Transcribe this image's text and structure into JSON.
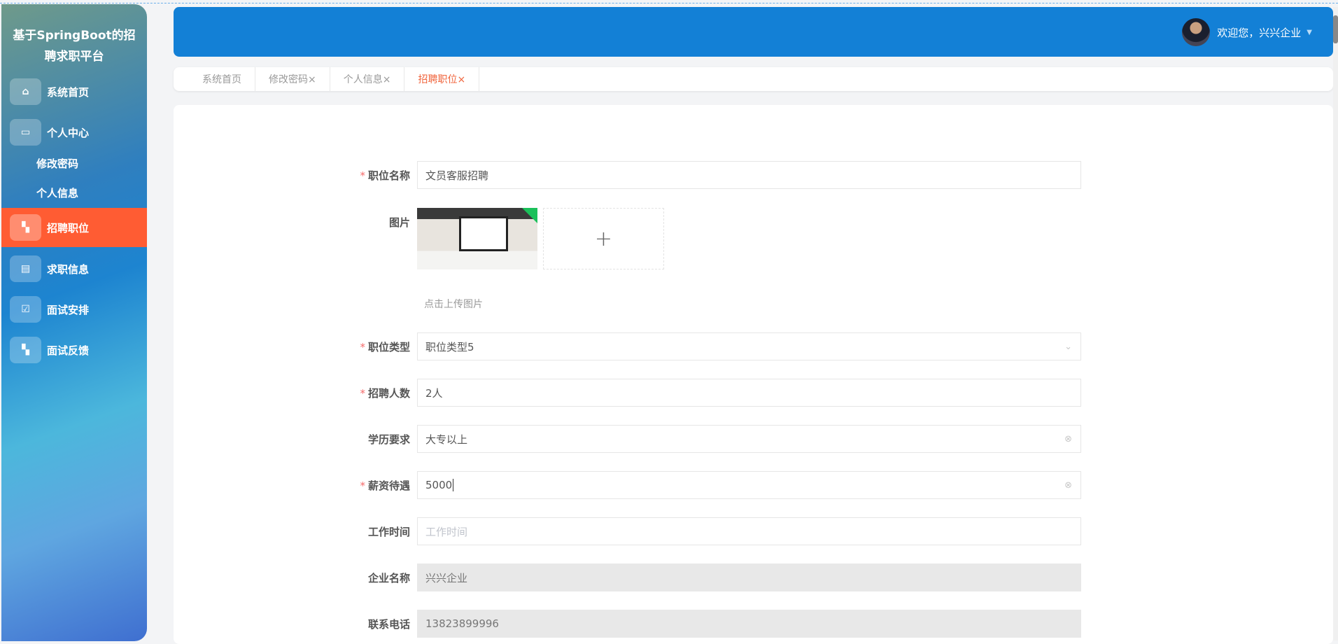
{
  "sidebar": {
    "title": "基于SpringBoot的招聘求职平台",
    "items": [
      {
        "label": "系统首页",
        "icon": "home-icon"
      },
      {
        "label": "个人中心",
        "icon": "wallet-icon"
      },
      {
        "label": "修改密码"
      },
      {
        "label": "个人信息"
      },
      {
        "label": "招聘职位",
        "icon": "grid-icon",
        "active": true
      },
      {
        "label": "求职信息",
        "icon": "clipboard-icon"
      },
      {
        "label": "面试安排",
        "icon": "clipboard-check-icon"
      },
      {
        "label": "面试反馈",
        "icon": "grid-icon"
      }
    ]
  },
  "header": {
    "welcome": "欢迎您，兴兴企业"
  },
  "tabs": [
    "系统首页",
    "修改密码×",
    "个人信息×",
    "招聘职位×"
  ],
  "form": {
    "job_name": {
      "label": "职位名称",
      "value": "文员客服招聘"
    },
    "image": {
      "label": "图片",
      "hint": "点击上传图片",
      "plus": "+"
    },
    "job_type": {
      "label": "职位类型",
      "value": "职位类型5"
    },
    "headcount": {
      "label": "招聘人数",
      "value": "2人"
    },
    "education": {
      "label": "学历要求",
      "value": "大专以上"
    },
    "salary": {
      "label": "薪资待遇",
      "value": "5000"
    },
    "work_time": {
      "label": "工作时间",
      "placeholder": "工作时间"
    },
    "company": {
      "label": "企业名称",
      "value": "兴兴企业"
    },
    "phone": {
      "label": "联系电话",
      "value": "13823899996"
    }
  },
  "colors": {
    "accent": "#ff5c33",
    "header": "#1380d6"
  }
}
